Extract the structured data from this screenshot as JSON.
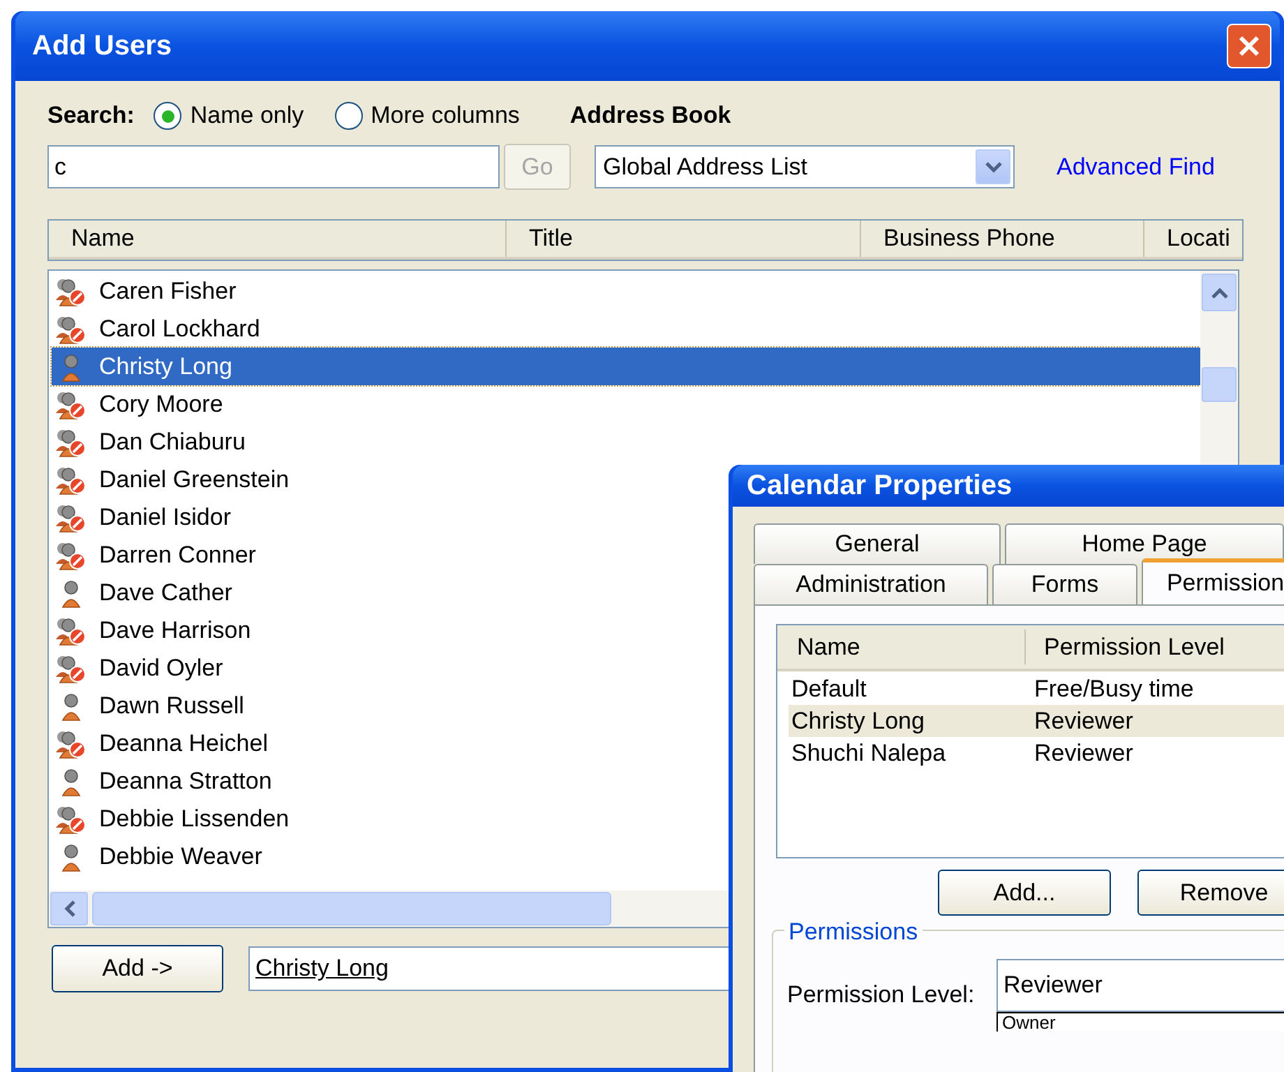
{
  "add_users": {
    "title": "Add Users",
    "search": {
      "label": "Search:",
      "options": [
        {
          "label": "Name only",
          "selected": true
        },
        {
          "label": "More columns",
          "selected": false
        }
      ],
      "value": "c",
      "go": "Go",
      "go_disabled": true
    },
    "address_book": {
      "label": "Address Book",
      "value": "Global Address List"
    },
    "advanced_find": "Advanced Find",
    "columns": [
      "Name",
      "Title",
      "Business Phone",
      "Locati"
    ],
    "users": [
      {
        "name": "Caren Fisher",
        "kind": "blocked",
        "selected": false
      },
      {
        "name": "Carol Lockhard",
        "kind": "blocked",
        "selected": false
      },
      {
        "name": "Christy Long",
        "kind": "user",
        "selected": true
      },
      {
        "name": "Cory Moore",
        "kind": "blocked",
        "selected": false
      },
      {
        "name": "Dan Chiaburu",
        "kind": "blocked",
        "selected": false
      },
      {
        "name": "Daniel Greenstein",
        "kind": "blocked",
        "selected": false
      },
      {
        "name": "Daniel Isidor",
        "kind": "blocked",
        "selected": false
      },
      {
        "name": "Darren Conner",
        "kind": "blocked",
        "selected": false
      },
      {
        "name": "Dave Cather",
        "kind": "user",
        "selected": false
      },
      {
        "name": "Dave Harrison",
        "kind": "blocked",
        "selected": false
      },
      {
        "name": "David Oyler",
        "kind": "blocked",
        "selected": false
      },
      {
        "name": "Dawn Russell",
        "kind": "user",
        "selected": false
      },
      {
        "name": "Deanna Heichel",
        "kind": "blocked",
        "selected": false
      },
      {
        "name": "Deanna Stratton",
        "kind": "user",
        "selected": false
      },
      {
        "name": "Debbie Lissenden",
        "kind": "blocked",
        "selected": false
      },
      {
        "name": "Debbie Weaver",
        "kind": "user",
        "selected": false
      }
    ],
    "add_button": "Add ->",
    "recipients": {
      "value": "Christy Long",
      "resolved": true
    }
  },
  "calendar_properties": {
    "title": "Calendar Properties",
    "tab_rows": [
      [
        {
          "label": "General",
          "selected": false
        },
        {
          "label": "Home Page",
          "selected": false
        }
      ],
      [
        {
          "label": "Administration",
          "selected": false
        },
        {
          "label": "Forms",
          "selected": false
        },
        {
          "label": "Permission",
          "selected": true
        }
      ]
    ],
    "permissions_table": {
      "columns": [
        "Name",
        "Permission Level"
      ],
      "rows": [
        {
          "name": "Default",
          "permission": "Free/Busy time",
          "selected": false
        },
        {
          "name": "Christy Long",
          "permission": "Reviewer",
          "selected": true
        },
        {
          "name": "Shuchi Nalepa",
          "permission": "Reviewer",
          "selected": false
        }
      ]
    },
    "buttons": [
      "Add...",
      "Remove"
    ],
    "group_label": "Permissions",
    "permission_level": {
      "label": "Permission Level:",
      "value": "Reviewer",
      "options": [
        "Owner"
      ]
    }
  }
}
